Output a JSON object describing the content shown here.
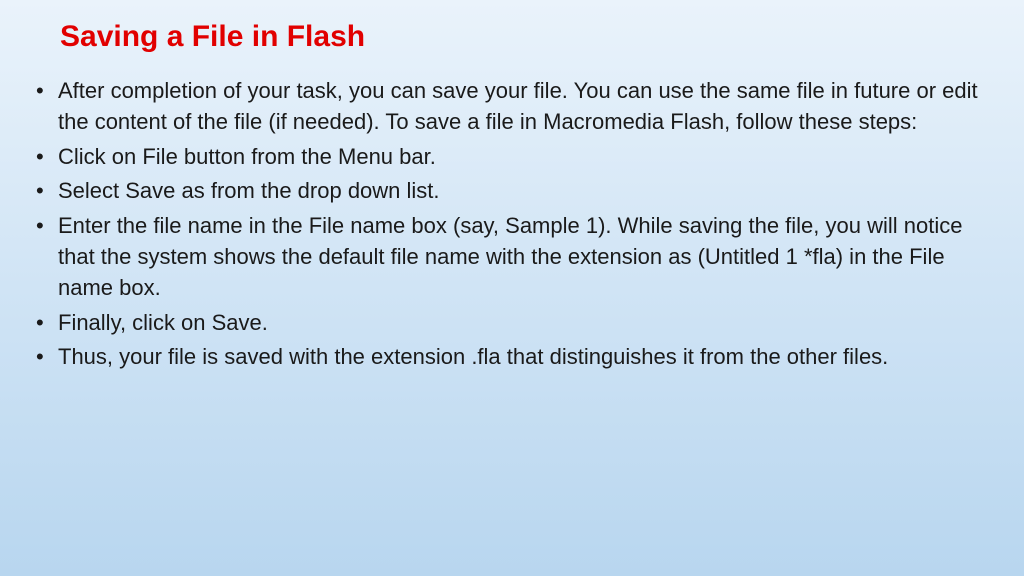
{
  "slide": {
    "title": "Saving a File in Flash",
    "bullets": [
      " After completion of your task, you can save your file. You can use the same file in future or edit the content of the file (if needed). To save a file in Macromedia Flash, follow these steps:",
      "Click on File button from the Menu bar.",
      "Select Save as from the drop down list.",
      "Enter the file name in the File name box (say, Sample 1). While saving the file, you will notice that the system shows the default file name with the extension as (Untitled 1 *fla) in the File name box.",
      "Finally, click on Save.",
      "Thus, your file is saved with the extension .fla that distinguishes it from the other files."
    ]
  }
}
